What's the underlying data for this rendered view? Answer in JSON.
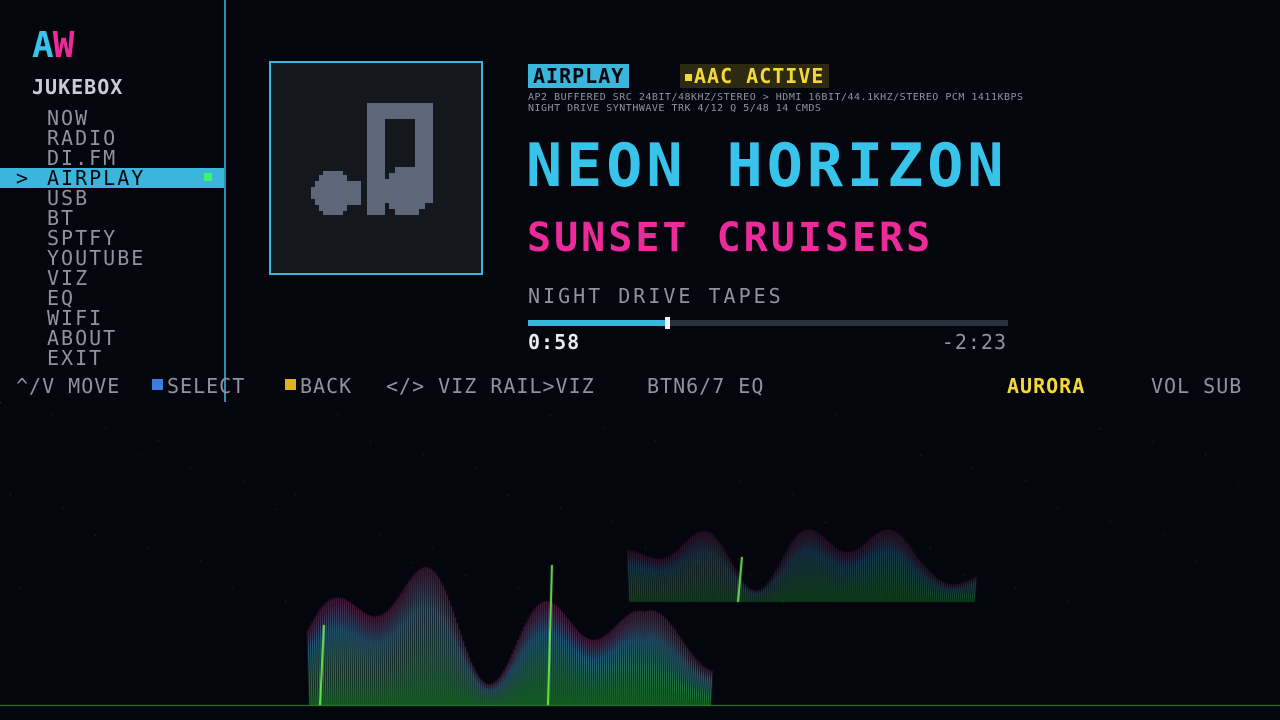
{
  "sidebar": {
    "logo_part1": "A",
    "logo_part2": "W",
    "title": "JUKEBOX",
    "active_caret": ">",
    "items": [
      {
        "label": "NOW"
      },
      {
        "label": "RADIO"
      },
      {
        "label": "DI.FM"
      },
      {
        "label": "AIRPLAY"
      },
      {
        "label": "USB"
      },
      {
        "label": "BT"
      },
      {
        "label": "SPTFY"
      },
      {
        "label": "YOUTUBE"
      },
      {
        "label": "VIZ"
      },
      {
        "label": "EQ"
      },
      {
        "label": "WIFI"
      },
      {
        "label": "ABOUT"
      },
      {
        "label": "EXIT"
      }
    ]
  },
  "now_playing": {
    "source_badge": "AIRPLAY",
    "codec_badge": "AAC ACTIVE",
    "status_line_1": "AP2 BUFFERED  SRC 24BIT/48KHZ/STEREO > HDMI 16BIT/44.1KHZ/STEREO  PCM 1411KBPS",
    "status_line_2": "NIGHT DRIVE  SYNTHWAVE  TRK 4/12  Q 5/48  14 CMDS",
    "title": "NEON HORIZON",
    "artist": "SUNSET CRUISERS",
    "album": "NIGHT DRIVE TAPES",
    "progress": 0.29,
    "elapsed": "0:58",
    "remaining": "-2:23"
  },
  "hints": {
    "move": "^/V MOVE",
    "select": "SELECT",
    "back": "BACK",
    "viz": "</> VIZ RAIL>VIZ",
    "eq": "BTN6/7 EQ",
    "preset": "AURORA",
    "vol": "VOL SUB"
  },
  "colors": {
    "cyan": "#38c4ea",
    "magenta": "#ee2a9b",
    "yellow": "#f3d838",
    "green": "#3ff06b",
    "select_key": "#3b7de0",
    "back_key": "#e0b21e"
  },
  "icons": {
    "album_art": "music-note-icon"
  }
}
